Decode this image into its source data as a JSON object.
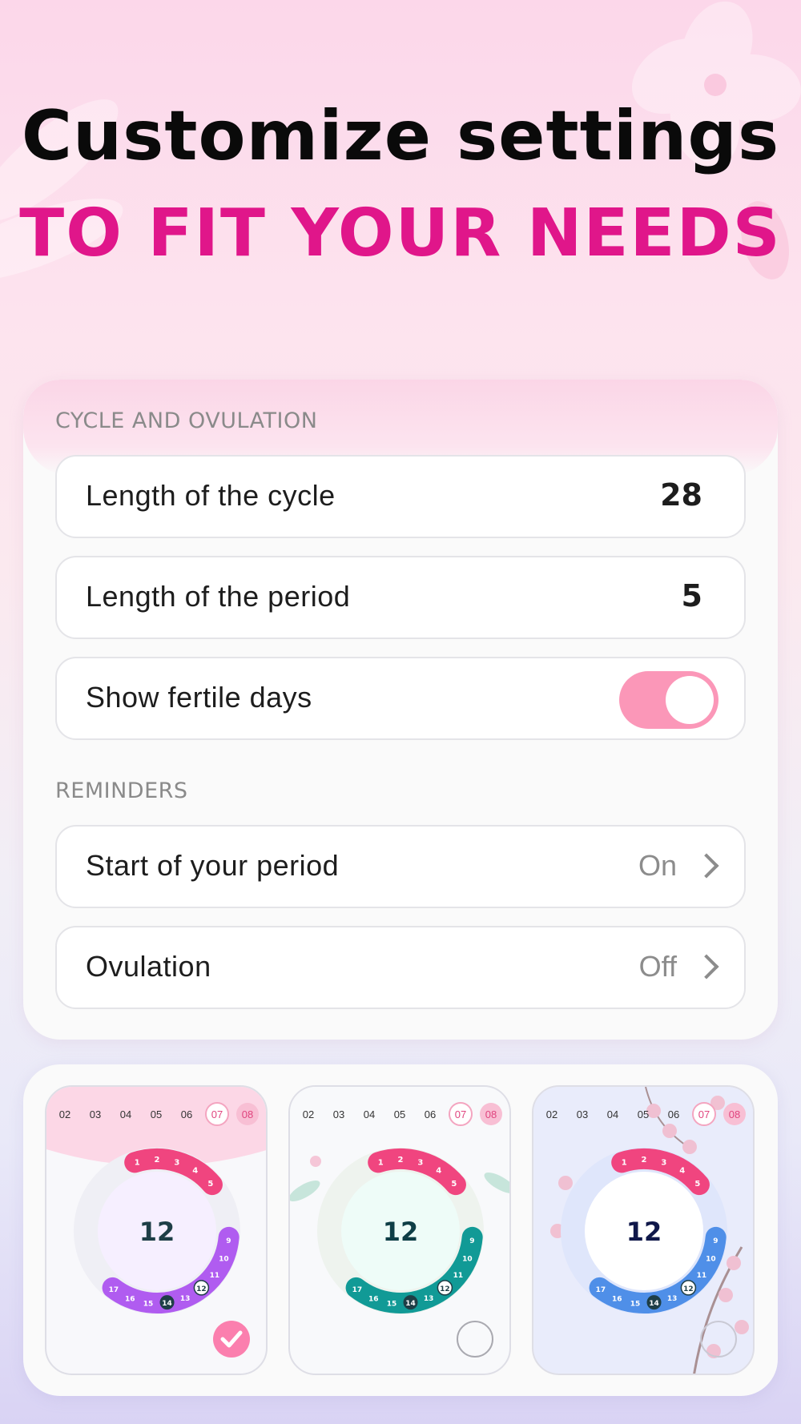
{
  "hero": {
    "title": "Customize settings",
    "subtitle": "TO FIT YOUR NEEDS"
  },
  "settings": {
    "section1_label": "CYCLE AND OVULATION",
    "cycle_length_label": "Length of the cycle",
    "cycle_length_value": "28",
    "period_length_label": "Length of the period",
    "period_length_value": "5",
    "fertile_label": "Show fertile days",
    "fertile_enabled": true,
    "section2_label": "REMINDERS",
    "period_reminder_label": "Start of your period",
    "period_reminder_status": "On",
    "ovulation_label": "Ovulation",
    "ovulation_status": "Off"
  },
  "themes": {
    "dates": [
      "02",
      "03",
      "04",
      "05",
      "06",
      "07",
      "08"
    ],
    "center_day": "12",
    "period_days": [
      "1",
      "2",
      "3",
      "4",
      "5"
    ],
    "fertile_days": [
      "9",
      "10",
      "11",
      "12",
      "13",
      "14",
      "15",
      "16",
      "17"
    ],
    "items": [
      {
        "name": "purple",
        "selected": true,
        "accent": "#b05cf0",
        "period": "#f0457f",
        "bg": "#f8f8fb",
        "header": "#fcd7e6",
        "center": "#1e3e46",
        "ring": "#efeff5"
      },
      {
        "name": "teal",
        "selected": false,
        "accent": "#119a96",
        "period": "#f0457f",
        "bg": "#f8f9fb",
        "header": "#f8f9fb",
        "center": "#0e3e46",
        "ring": "#eef3ee"
      },
      {
        "name": "blossom",
        "selected": false,
        "accent": "#4f8fe8",
        "period": "#f0457f",
        "bg": "#e9ecfb",
        "header": "#e9ecfb",
        "center": "#10184a",
        "ring": "#dfe6fb"
      }
    ]
  },
  "colors": {
    "accent_pink": "#e0168a",
    "toggle_on": "#fb97b8"
  }
}
